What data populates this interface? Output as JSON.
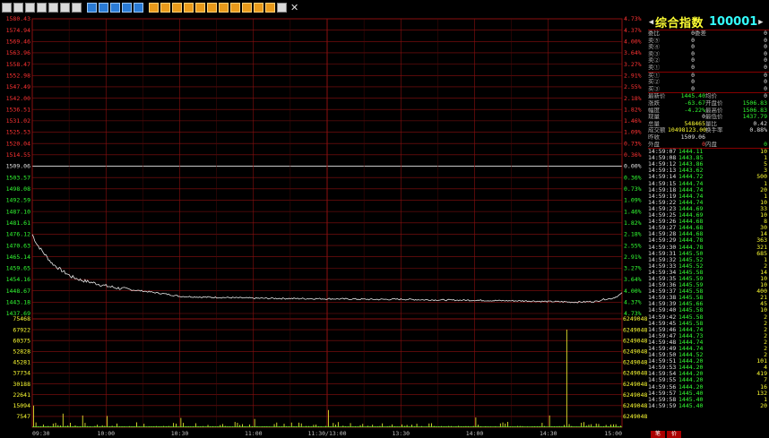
{
  "toolbar": {
    "icons": [
      "back-icon",
      "refresh-icon",
      "chart-icon",
      "document-icon",
      "kline-icon",
      "settings-icon",
      "window-icon",
      "b-icon-1",
      "b-icon-2",
      "b-icon-3",
      "b-icon-4",
      "b-icon-5",
      "o-icon-1",
      "o-icon-2",
      "o-icon-3",
      "o-icon-4",
      "o-icon-5",
      "o-icon-6",
      "o-icon-7",
      "o-icon-8",
      "o-icon-9",
      "o-icon-10",
      "o-icon-11",
      "note-icon",
      "close-icon"
    ],
    "close_label": "✕"
  },
  "chart_data": [
    {
      "type": "line",
      "prev_close": 1509.06,
      "ylim": [
        1437.69,
        1580.43
      ],
      "price_ticks": [
        "1580.43",
        "1574.94",
        "1569.46",
        "1563.96",
        "1558.47",
        "1552.98",
        "1547.49",
        "1542.00",
        "1536.51",
        "1531.02",
        "1525.53",
        "1520.04",
        "1514.55",
        "1509.06",
        "1503.57",
        "1498.08",
        "1492.59",
        "1487.10",
        "1481.61",
        "1476.12",
        "1470.63",
        "1465.14",
        "1459.65",
        "1454.16",
        "1448.67",
        "1443.18",
        "1437.69"
      ],
      "pct_ticks": [
        "4.73%",
        "4.37%",
        "4.00%",
        "3.64%",
        "3.27%",
        "2.91%",
        "2.55%",
        "2.18%",
        "1.82%",
        "1.46%",
        "1.09%",
        "0.73%",
        "0.36%",
        "0.00%",
        "0.36%",
        "0.73%",
        "1.09%",
        "1.46%",
        "1.82%",
        "2.18%",
        "2.55%",
        "2.91%",
        "3.27%",
        "3.64%",
        "4.00%",
        "4.37%",
        "4.73%"
      ],
      "time_labels": [
        "09:30",
        "10:00",
        "10:30",
        "11:00",
        "11:30/13:00",
        "13:30",
        "14:00",
        "14:30",
        "15:00"
      ],
      "price_series": [
        [
          0,
          1476.0
        ],
        [
          2,
          1471.0
        ],
        [
          5,
          1466.5
        ],
        [
          8,
          1462.0
        ],
        [
          12,
          1458.5
        ],
        [
          16,
          1455.5
        ],
        [
          20,
          1453.8
        ],
        [
          25,
          1452.5
        ],
        [
          30,
          1451.0
        ],
        [
          35,
          1450.0
        ],
        [
          40,
          1449.2
        ],
        [
          45,
          1448.6
        ],
        [
          50,
          1447.8
        ],
        [
          55,
          1447.0
        ],
        [
          60,
          1446.0
        ],
        [
          70,
          1445.6
        ],
        [
          80,
          1445.4
        ],
        [
          90,
          1445.1
        ],
        [
          100,
          1445.0
        ],
        [
          110,
          1444.9
        ],
        [
          120,
          1444.8
        ],
        [
          130,
          1444.7
        ],
        [
          140,
          1444.5
        ],
        [
          150,
          1444.6
        ],
        [
          160,
          1444.3
        ],
        [
          170,
          1444.2
        ],
        [
          180,
          1444.1
        ],
        [
          190,
          1443.9
        ],
        [
          200,
          1443.8
        ],
        [
          210,
          1443.5
        ],
        [
          215,
          1443.4
        ],
        [
          220,
          1443.2
        ],
        [
          225,
          1443.3
        ],
        [
          230,
          1443.6
        ],
        [
          232,
          1444.5
        ],
        [
          236,
          1445.0
        ],
        [
          238,
          1446.0
        ],
        [
          240,
          1447.5
        ]
      ]
    },
    {
      "type": "bar",
      "ylim": [
        0,
        75468
      ],
      "vol_ticks": [
        "75468",
        "67922",
        "60375",
        "52828",
        "45281",
        "37734",
        "30188",
        "22641",
        "15094",
        "7547"
      ],
      "right_ticks": [
        "624904800",
        "624904800",
        "624904800",
        "624904800",
        "624904800",
        "624904800",
        "624904800",
        "624904800",
        "624904800",
        "624904800"
      ],
      "spikes": [
        [
          0,
          15094
        ],
        [
          12,
          9500
        ],
        [
          20,
          8200
        ],
        [
          30,
          7900
        ],
        [
          60,
          6500
        ],
        [
          90,
          5800
        ],
        [
          120,
          12000
        ],
        [
          180,
          6800
        ],
        [
          210,
          8200
        ],
        [
          217,
          68000
        ],
        [
          234,
          4200
        ]
      ]
    }
  ],
  "panel": {
    "title": "综合指数",
    "code": "100001",
    "rows1": [
      {
        "l": "委比",
        "v": "0",
        "l2": "委差",
        "v2": "0"
      },
      {
        "l": "卖⑤",
        "v": "0",
        "l2": "",
        "v2": "0"
      },
      {
        "l": "卖④",
        "v": "0",
        "l2": "",
        "v2": "0"
      },
      {
        "l": "卖③",
        "v": "0",
        "l2": "",
        "v2": "0"
      },
      {
        "l": "卖②",
        "v": "0",
        "l2": "",
        "v2": "0"
      },
      {
        "l": "卖①",
        "v": "0",
        "l2": "",
        "v2": "0"
      }
    ],
    "rows2": [
      {
        "l": "买①",
        "v": "0",
        "l2": "",
        "v2": "0"
      },
      {
        "l": "买②",
        "v": "0",
        "l2": "",
        "v2": "0"
      },
      {
        "l": "买③",
        "v": "0",
        "l2": "",
        "v2": "0"
      }
    ],
    "quote": [
      {
        "l": "最新价",
        "v": "1445.40",
        "l2": "均价",
        "v2": "0",
        "c": "grn",
        "c2": "wht"
      },
      {
        "l": "涨跌",
        "v": "-63.67",
        "l2": "开盘价",
        "v2": "1506.83",
        "c": "grn",
        "c2": "grn"
      },
      {
        "l": "幅度",
        "v": "-4.22%",
        "l2": "最高价",
        "v2": "1506.83",
        "c": "grn",
        "c2": "grn"
      },
      {
        "l": "现量",
        "v": "0",
        "l2": "最低价",
        "v2": "1437.79",
        "c": "wht",
        "c2": "grn"
      },
      {
        "l": "总量",
        "v": "548465",
        "l2": "量比",
        "v2": "0.42",
        "c": "yel",
        "c2": "wht"
      },
      {
        "l": "成交额",
        "v": "10498123.00",
        "l2": "换手率",
        "v2": "0.88%",
        "c": "yel",
        "c2": "wht"
      },
      {
        "l": "昨收",
        "v": "1509.06",
        "l2": "",
        "v2": "",
        "c": "wht",
        "c2": "wht"
      },
      {
        "l": "外盘",
        "v": "0",
        "l2": "内盘",
        "v2": "0",
        "c": "red",
        "c2": "grn"
      }
    ],
    "ticks": [
      {
        "t": "14:59:07",
        "p": "1444.11",
        "v": "10"
      },
      {
        "t": "14:59:08",
        "p": "1443.85",
        "v": "1"
      },
      {
        "t": "14:59:12",
        "p": "1443.86",
        "v": "5"
      },
      {
        "t": "14:59:13",
        "p": "1443.62",
        "v": "3"
      },
      {
        "t": "14:59:14",
        "p": "1444.72",
        "v": "500"
      },
      {
        "t": "14:59:15",
        "p": "1444.74",
        "v": "1"
      },
      {
        "t": "14:59:18",
        "p": "1444.74",
        "v": "20"
      },
      {
        "t": "14:59:19",
        "p": "1444.74",
        "v": "1"
      },
      {
        "t": "14:59:22",
        "p": "1444.74",
        "v": "10"
      },
      {
        "t": "14:59:23",
        "p": "1444.69",
        "v": "33"
      },
      {
        "t": "14:59:25",
        "p": "1444.69",
        "v": "10"
      },
      {
        "t": "14:59:26",
        "p": "1444.68",
        "v": "8"
      },
      {
        "t": "14:59:27",
        "p": "1444.68",
        "v": "30"
      },
      {
        "t": "14:59:28",
        "p": "1444.68",
        "v": "14"
      },
      {
        "t": "14:59:29",
        "p": "1444.78",
        "v": "363"
      },
      {
        "t": "14:59:30",
        "p": "1444.78",
        "v": "321"
      },
      {
        "t": "14:59:31",
        "p": "1445.50",
        "v": "685"
      },
      {
        "t": "14:59:32",
        "p": "1445.52",
        "v": "1"
      },
      {
        "t": "14:59:33",
        "p": "1445.52",
        "v": "2"
      },
      {
        "t": "14:59:34",
        "p": "1445.58",
        "v": "14"
      },
      {
        "t": "14:59:35",
        "p": "1445.59",
        "v": "10"
      },
      {
        "t": "14:59:36",
        "p": "1445.59",
        "v": "10"
      },
      {
        "t": "14:59:37",
        "p": "1445.58",
        "v": "400"
      },
      {
        "t": "14:59:38",
        "p": "1445.58",
        "v": "21"
      },
      {
        "t": "14:59:39",
        "p": "1445.66",
        "v": "45"
      },
      {
        "t": "14:59:40",
        "p": "1445.58",
        "v": "10"
      },
      {
        "t": "14:59:42",
        "p": "1445.58",
        "v": "2"
      },
      {
        "t": "14:59:45",
        "p": "1445.58",
        "v": "2"
      },
      {
        "t": "14:59:46",
        "p": "1444.74",
        "v": "2"
      },
      {
        "t": "14:59:47",
        "p": "1444.73",
        "v": "2"
      },
      {
        "t": "14:59:48",
        "p": "1444.74",
        "v": "2"
      },
      {
        "t": "14:59:49",
        "p": "1444.74",
        "v": "2"
      },
      {
        "t": "14:59:50",
        "p": "1444.52",
        "v": "2"
      },
      {
        "t": "14:59:51",
        "p": "1444.20",
        "v": "101"
      },
      {
        "t": "14:59:53",
        "p": "1444.20",
        "v": "4"
      },
      {
        "t": "14:59:54",
        "p": "1444.20",
        "v": "419"
      },
      {
        "t": "14:59:55",
        "p": "1444.20",
        "v": "7"
      },
      {
        "t": "14:59:56",
        "p": "1444.20",
        "v": "16"
      },
      {
        "t": "14:59:57",
        "p": "1445.40",
        "v": "132"
      },
      {
        "t": "14:59:58",
        "p": "1445.40",
        "v": "1"
      },
      {
        "t": "14:59:59",
        "p": "1445.40",
        "v": "20"
      }
    ],
    "tabs": [
      "笔",
      "价"
    ]
  }
}
